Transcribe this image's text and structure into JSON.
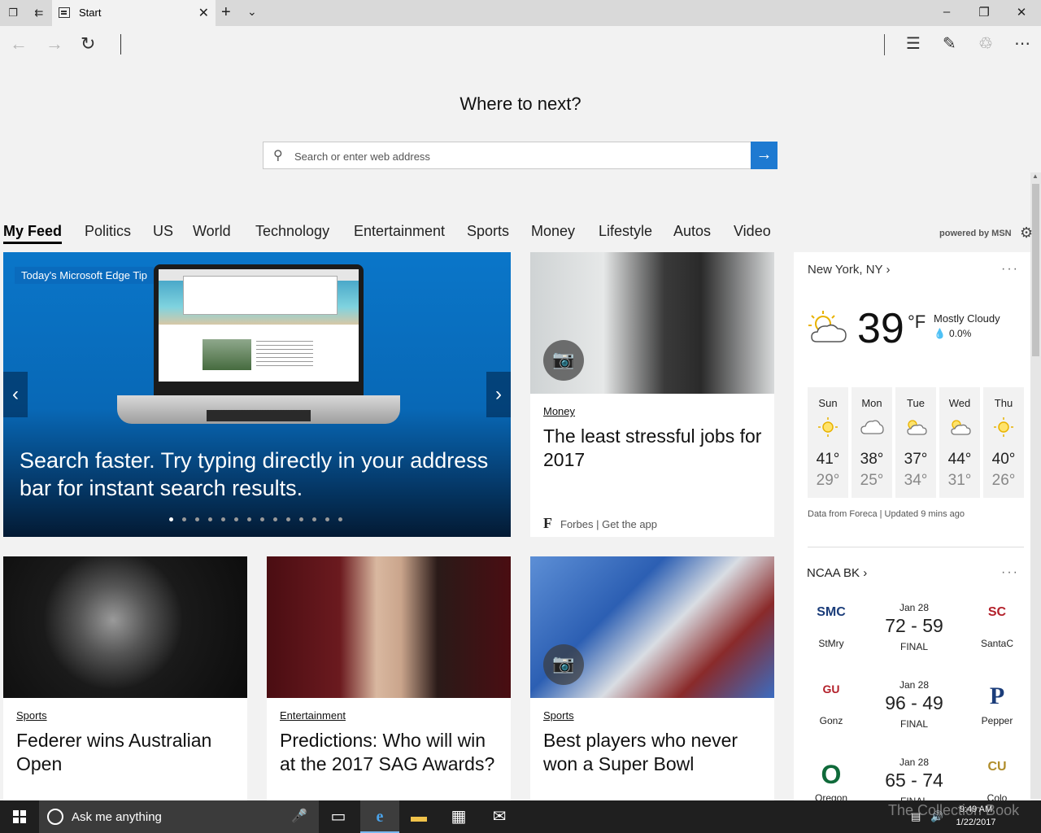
{
  "browser": {
    "tab_title": "Start",
    "address_placeholder": "Search or enter web address"
  },
  "start": {
    "heading": "Where to next?",
    "search_placeholder": "Search or enter web address"
  },
  "categories": [
    "My Feed",
    "Politics",
    "US",
    "World",
    "Technology",
    "Entertainment",
    "Sports",
    "Money",
    "Lifestyle",
    "Autos",
    "Video"
  ],
  "active_category": "My Feed",
  "powered_by": "powered by MSN",
  "hero": {
    "tip_label": "Today's Microsoft Edge Tip",
    "headline": "Search faster. Try typing directly in your address bar for instant search results.",
    "slide_count": 14,
    "active_slide": 1
  },
  "cards": [
    {
      "category": "Money",
      "title": "The least stressful jobs for 2017",
      "source": "Forbes",
      "source_extra": "| Get the app"
    },
    {
      "category": "Sports",
      "title": "Federer wins Australian Open"
    },
    {
      "category": "Entertainment",
      "title": "Predictions: Who will win at the 2017 SAG Awards?"
    },
    {
      "category": "Sports",
      "title": "Best players who never won a Super Bowl"
    }
  ],
  "weather": {
    "location": "New York, NY",
    "temperature": "39",
    "unit": "°F",
    "condition": "Mostly Cloudy",
    "precip": "0.0%",
    "forecast": [
      {
        "day": "Sun",
        "icon": "sun-icon",
        "high": "41°",
        "low": "29°"
      },
      {
        "day": "Mon",
        "icon": "cloud-icon",
        "high": "38°",
        "low": "25°"
      },
      {
        "day": "Tue",
        "icon": "partly-sunny-icon",
        "high": "37°",
        "low": "34°"
      },
      {
        "day": "Wed",
        "icon": "partly-sunny-icon",
        "high": "44°",
        "low": "31°"
      },
      {
        "day": "Thu",
        "icon": "sun-icon",
        "high": "40°",
        "low": "26°"
      }
    ],
    "source": "Data from Foreca | Updated 9 mins ago"
  },
  "ncaa": {
    "title": "NCAA BK",
    "games": [
      {
        "date": "Jan 28",
        "score": "72 - 59",
        "status": "FINAL",
        "home": "StMry",
        "away": "SantaC",
        "home_logo": "SMC",
        "away_logo": "SC"
      },
      {
        "date": "Jan 28",
        "score": "96 - 49",
        "status": "FINAL",
        "home": "Gonz",
        "away": "Pepper",
        "home_logo": "GU",
        "away_logo": "P"
      },
      {
        "date": "Jan 28",
        "score": "65 - 74",
        "status": "FINAL",
        "home": "Oregon",
        "away": "Colo",
        "home_logo": "O",
        "away_logo": "CU"
      }
    ]
  },
  "taskbar": {
    "search_text": "Ask me anything",
    "time": "9:49 AM",
    "date": "1/22/2017"
  },
  "watermark": "The Collection Book",
  "colors": {
    "accent": "#1e7ad1",
    "hero_bg": "#0a76c9"
  }
}
